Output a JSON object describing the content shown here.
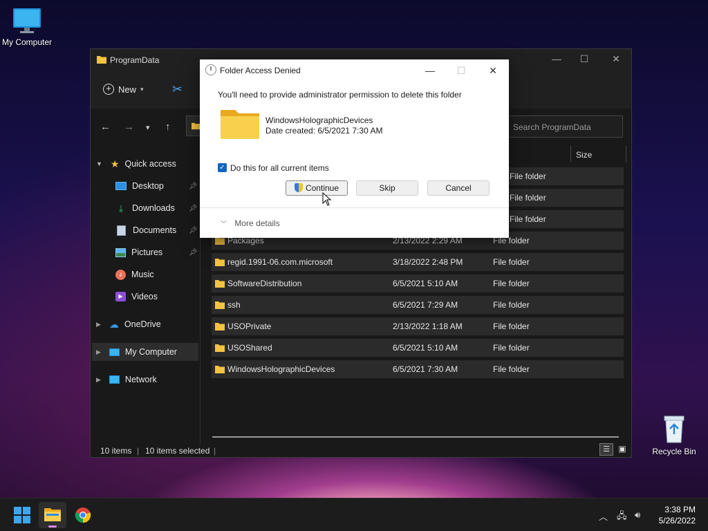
{
  "desktop": {
    "my_computer_label": "My Computer",
    "recycle_bin_label": "Recycle Bin"
  },
  "explorer": {
    "title": "ProgramData",
    "new_label": "New",
    "search_placeholder": "Search ProgramData",
    "column_size": "Size",
    "sidebar": [
      {
        "label": "Quick access"
      },
      {
        "label": "Desktop"
      },
      {
        "label": "Downloads"
      },
      {
        "label": "Documents"
      },
      {
        "label": "Pictures"
      },
      {
        "label": "Music"
      },
      {
        "label": "Videos"
      },
      {
        "label": "OneDrive"
      },
      {
        "label": "My Computer"
      },
      {
        "label": "Network"
      }
    ],
    "rows": [
      {
        "name": "",
        "date": "",
        "type": "File folder"
      },
      {
        "name": "",
        "date": "",
        "type": "File folder"
      },
      {
        "name": "",
        "date": "",
        "type": "File folder"
      },
      {
        "name": "Packages",
        "date": "2/13/2022 2:29 AM",
        "type": "File folder"
      },
      {
        "name": "regid.1991-06.com.microsoft",
        "date": "3/18/2022 2:48 PM",
        "type": "File folder"
      },
      {
        "name": "SoftwareDistribution",
        "date": "6/5/2021 5:10 AM",
        "type": "File folder"
      },
      {
        "name": "ssh",
        "date": "6/5/2021 7:29 AM",
        "type": "File folder"
      },
      {
        "name": "USOPrivate",
        "date": "2/13/2022 1:18 AM",
        "type": "File folder"
      },
      {
        "name": "USOShared",
        "date": "6/5/2021 5:10 AM",
        "type": "File folder"
      },
      {
        "name": "WindowsHolographicDevices",
        "date": "6/5/2021 7:30 AM",
        "type": "File folder"
      }
    ],
    "status": {
      "count": "10 items",
      "selected": "10 items selected"
    }
  },
  "dialog": {
    "title": "Folder Access Denied",
    "message": "You'll need to provide administrator permission to delete this folder",
    "folder_name": "WindowsHolographicDevices",
    "date_created": "Date created: 6/5/2021 7:30 AM",
    "checkbox_label": "Do this for all current items",
    "continue_label": "Continue",
    "skip_label": "Skip",
    "cancel_label": "Cancel",
    "more_details_label": "More details"
  },
  "taskbar": {
    "time": "3:38 PM",
    "date": "5/26/2022"
  },
  "colors": {
    "accent": "#1565c0",
    "folder_yellow": "#f5c342"
  }
}
